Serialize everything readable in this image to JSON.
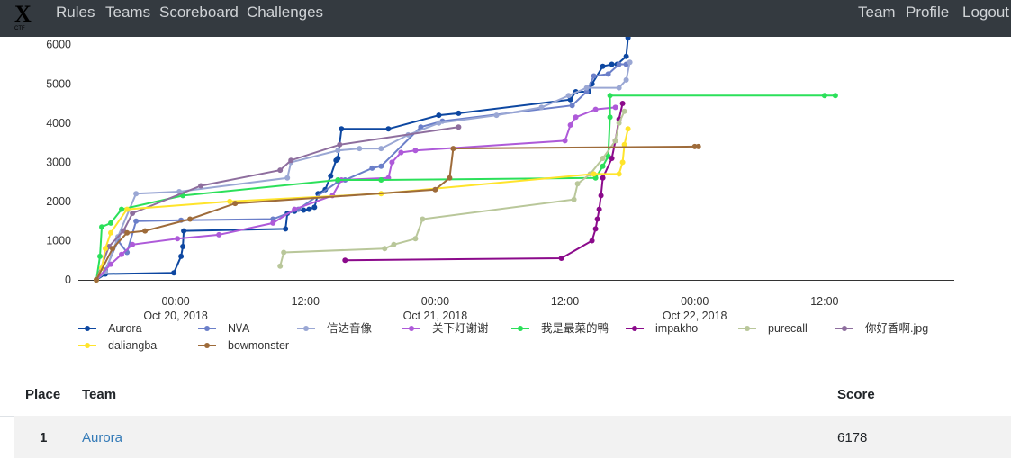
{
  "navbar": {
    "brand_icon": "x-logo-icon",
    "links_left": [
      "Rules",
      "Teams",
      "Scoreboard",
      "Challenges"
    ],
    "links_right": [
      "Team",
      "Profile",
      "Logout"
    ]
  },
  "chart_data": {
    "type": "line",
    "x_axis": {
      "ticks": [
        {
          "value": "2018-10-20 00:00",
          "label": [
            "00:00",
            "Oct 20, 2018"
          ]
        },
        {
          "value": "2018-10-20 12:00",
          "label": [
            "12:00",
            ""
          ]
        },
        {
          "value": "2018-10-21 00:00",
          "label": [
            "00:00",
            "Oct 21, 2018"
          ]
        },
        {
          "value": "2018-10-21 12:00",
          "label": [
            "12:00",
            ""
          ]
        },
        {
          "value": "2018-10-22 00:00",
          "label": [
            "00:00",
            "Oct 22, 2018"
          ]
        },
        {
          "value": "2018-10-22 12:00",
          "label": [
            "12:00",
            ""
          ]
        }
      ],
      "range": [
        "2018-10-19 15:00",
        "2018-10-23 00:00"
      ]
    },
    "y_axis": {
      "ticks": [
        0,
        1000,
        2000,
        3000,
        4000,
        5000,
        6000
      ],
      "range": [
        0,
        6200
      ]
    },
    "legend_position": "bottom",
    "series": [
      {
        "name": "Aurora",
        "color": "#0d47a1",
        "points": [
          [
            "2018-10-19 16:40",
            0
          ],
          [
            "2018-10-19 17:30",
            150
          ],
          [
            "2018-10-19 23:50",
            180
          ],
          [
            "2018-10-20 00:30",
            600
          ],
          [
            "2018-10-20 00:40",
            850
          ],
          [
            "2018-10-20 00:45",
            1250
          ],
          [
            "2018-10-20 10:10",
            1300
          ],
          [
            "2018-10-20 10:20",
            1700
          ],
          [
            "2018-10-20 11:00",
            1750
          ],
          [
            "2018-10-20 11:50",
            1780
          ],
          [
            "2018-10-20 12:20",
            1800
          ],
          [
            "2018-10-20 12:50",
            1850
          ],
          [
            "2018-10-20 13:10",
            2200
          ],
          [
            "2018-10-20 13:50",
            2300
          ],
          [
            "2018-10-20 14:20",
            2650
          ],
          [
            "2018-10-20 14:50",
            3050
          ],
          [
            "2018-10-20 15:00",
            3100
          ],
          [
            "2018-10-20 15:20",
            3850
          ],
          [
            "2018-10-20 19:40",
            3850
          ],
          [
            "2018-10-21 00:20",
            4200
          ],
          [
            "2018-10-21 02:10",
            4250
          ],
          [
            "2018-10-21 12:30",
            4600
          ],
          [
            "2018-10-21 13:00",
            4800
          ],
          [
            "2018-10-21 14:10",
            4800
          ],
          [
            "2018-10-21 14:30",
            5000
          ],
          [
            "2018-10-21 15:30",
            5450
          ],
          [
            "2018-10-21 16:20",
            5500
          ],
          [
            "2018-10-21 16:50",
            5500
          ],
          [
            "2018-10-21 17:40",
            5700
          ],
          [
            "2018-10-21 17:50",
            6178
          ]
        ]
      },
      {
        "name": "N\\/A",
        "color": "#6b7fc9",
        "points": [
          [
            "2018-10-19 16:40",
            0
          ],
          [
            "2018-10-19 17:30",
            250
          ],
          [
            "2018-10-19 18:40",
            1000
          ],
          [
            "2018-10-19 19:30",
            700
          ],
          [
            "2018-10-19 20:20",
            1500
          ],
          [
            "2018-10-20 00:30",
            1520
          ],
          [
            "2018-10-20 09:00",
            1550
          ],
          [
            "2018-10-20 11:20",
            1800
          ],
          [
            "2018-10-20 15:00",
            2500
          ],
          [
            "2018-10-20 15:40",
            2550
          ],
          [
            "2018-10-20 18:10",
            2850
          ],
          [
            "2018-10-20 19:00",
            2900
          ],
          [
            "2018-10-20 22:40",
            3900
          ],
          [
            "2018-10-21 00:40",
            4050
          ],
          [
            "2018-10-21 12:40",
            4450
          ],
          [
            "2018-10-21 14:00",
            4800
          ],
          [
            "2018-10-21 14:40",
            5200
          ],
          [
            "2018-10-21 16:00",
            5250
          ],
          [
            "2018-10-21 17:00",
            5500
          ],
          [
            "2018-10-21 17:40",
            5500
          ]
        ]
      },
      {
        "name": "信达音像",
        "color": "#9aa7d4",
        "points": [
          [
            "2018-10-19 16:40",
            0
          ],
          [
            "2018-10-19 17:30",
            200
          ],
          [
            "2018-10-19 18:40",
            1100
          ],
          [
            "2018-10-19 20:20",
            2200
          ],
          [
            "2018-10-20 00:20",
            2250
          ],
          [
            "2018-10-20 10:20",
            2600
          ],
          [
            "2018-10-20 10:40",
            3000
          ],
          [
            "2018-10-20 15:00",
            3300
          ],
          [
            "2018-10-20 17:00",
            3350
          ],
          [
            "2018-10-20 19:00",
            3350
          ],
          [
            "2018-10-20 21:30",
            3700
          ],
          [
            "2018-10-21 00:20",
            4000
          ],
          [
            "2018-10-21 05:40",
            4200
          ],
          [
            "2018-10-21 09:50",
            4400
          ],
          [
            "2018-10-21 12:20",
            4700
          ],
          [
            "2018-10-21 14:00",
            4900
          ],
          [
            "2018-10-21 17:00",
            4900
          ],
          [
            "2018-10-21 17:40",
            5100
          ],
          [
            "2018-10-21 18:00",
            5550
          ]
        ]
      },
      {
        "name": "关下灯谢谢",
        "color": "#ae5ad9",
        "points": [
          [
            "2018-10-19 16:40",
            0
          ],
          [
            "2018-10-19 18:00",
            400
          ],
          [
            "2018-10-19 19:00",
            650
          ],
          [
            "2018-10-19 20:00",
            900
          ],
          [
            "2018-10-20 00:10",
            1050
          ],
          [
            "2018-10-20 04:00",
            1150
          ],
          [
            "2018-10-20 09:00",
            1450
          ],
          [
            "2018-10-20 11:00",
            1800
          ],
          [
            "2018-10-20 14:30",
            2150
          ],
          [
            "2018-10-20 15:20",
            2550
          ],
          [
            "2018-10-20 19:40",
            2600
          ],
          [
            "2018-10-20 20:00",
            3000
          ],
          [
            "2018-10-20 20:50",
            3250
          ],
          [
            "2018-10-20 22:10",
            3300
          ],
          [
            "2018-10-21 12:00",
            3550
          ],
          [
            "2018-10-21 12:30",
            3950
          ],
          [
            "2018-10-21 13:00",
            4150
          ],
          [
            "2018-10-21 14:50",
            4350
          ],
          [
            "2018-10-21 16:40",
            4400
          ]
        ]
      },
      {
        "name": "我是最菜的鸭",
        "color": "#2be05a",
        "points": [
          [
            "2018-10-19 16:40",
            0
          ],
          [
            "2018-10-19 17:00",
            600
          ],
          [
            "2018-10-19 17:10",
            1350
          ],
          [
            "2018-10-19 18:00",
            1450
          ],
          [
            "2018-10-19 19:00",
            1800
          ],
          [
            "2018-10-20 00:40",
            2150
          ],
          [
            "2018-10-20 15:00",
            2550
          ],
          [
            "2018-10-20 19:00",
            2550
          ],
          [
            "2018-10-21 14:50",
            2600
          ],
          [
            "2018-10-21 15:30",
            2900
          ],
          [
            "2018-10-21 16:00",
            3150
          ],
          [
            "2018-10-21 16:10",
            4150
          ],
          [
            "2018-10-21 16:10",
            4700
          ],
          [
            "2018-10-22 12:00",
            4700
          ],
          [
            "2018-10-22 13:00",
            4700
          ]
        ]
      },
      {
        "name": "impakho",
        "color": "#8b0a8b",
        "points": [
          [
            "2018-10-20 15:40",
            500
          ],
          [
            "2018-10-21 11:40",
            550
          ],
          [
            "2018-10-21 14:30",
            1000
          ],
          [
            "2018-10-21 14:50",
            1300
          ],
          [
            "2018-10-21 15:00",
            1550
          ],
          [
            "2018-10-21 15:10",
            1800
          ],
          [
            "2018-10-21 15:20",
            2150
          ],
          [
            "2018-10-21 15:30",
            2600
          ],
          [
            "2018-10-21 16:20",
            3100
          ],
          [
            "2018-10-21 16:40",
            3550
          ],
          [
            "2018-10-21 17:00",
            4100
          ],
          [
            "2018-10-21 17:20",
            4500
          ]
        ]
      },
      {
        "name": "purecall",
        "color": "#b9c79a",
        "points": [
          [
            "2018-10-20 09:40",
            350
          ],
          [
            "2018-10-20 10:00",
            700
          ],
          [
            "2018-10-20 19:20",
            800
          ],
          [
            "2018-10-20 20:10",
            900
          ],
          [
            "2018-10-20 22:10",
            1050
          ],
          [
            "2018-10-20 22:50",
            1550
          ],
          [
            "2018-10-21 12:50",
            2050
          ],
          [
            "2018-10-21 13:10",
            2450
          ],
          [
            "2018-10-21 14:20",
            2700
          ],
          [
            "2018-10-21 15:30",
            3100
          ],
          [
            "2018-10-21 16:40",
            3550
          ],
          [
            "2018-10-21 17:00",
            4000
          ],
          [
            "2018-10-21 17:30",
            4300
          ]
        ]
      },
      {
        "name": "你好香啊.jpg",
        "color": "#8e6e9e",
        "points": [
          [
            "2018-10-19 16:40",
            0
          ],
          [
            "2018-10-19 17:50",
            850
          ],
          [
            "2018-10-19 19:10",
            1250
          ],
          [
            "2018-10-19 20:00",
            1700
          ],
          [
            "2018-10-20 02:20",
            2400
          ],
          [
            "2018-10-20 09:40",
            2800
          ],
          [
            "2018-10-20 10:40",
            3050
          ],
          [
            "2018-10-20 15:10",
            3450
          ],
          [
            "2018-10-21 02:10",
            3900
          ]
        ]
      },
      {
        "name": "daliangba",
        "color": "#ffe42b",
        "points": [
          [
            "2018-10-19 16:40",
            0
          ],
          [
            "2018-10-19 17:10",
            300
          ],
          [
            "2018-10-19 17:30",
            800
          ],
          [
            "2018-10-19 18:00",
            1200
          ],
          [
            "2018-10-19 19:30",
            1800
          ],
          [
            "2018-10-20 05:00",
            2000
          ],
          [
            "2018-10-20 19:00",
            2200
          ],
          [
            "2018-10-21 14:40",
            2700
          ],
          [
            "2018-10-21 17:00",
            2700
          ],
          [
            "2018-10-21 17:20",
            3000
          ],
          [
            "2018-10-21 17:30",
            3450
          ],
          [
            "2018-10-21 17:50",
            3850
          ]
        ]
      },
      {
        "name": "bowmonster",
        "color": "#9e6b3a",
        "points": [
          [
            "2018-10-19 16:40",
            0
          ],
          [
            "2018-10-19 18:10",
            800
          ],
          [
            "2018-10-19 19:30",
            1200
          ],
          [
            "2018-10-19 21:10",
            1250
          ],
          [
            "2018-10-20 01:20",
            1550
          ],
          [
            "2018-10-20 05:30",
            1950
          ],
          [
            "2018-10-21 00:00",
            2300
          ],
          [
            "2018-10-21 01:20",
            2600
          ],
          [
            "2018-10-21 01:40",
            3350
          ],
          [
            "2018-10-22 00:00",
            3400
          ],
          [
            "2018-10-22 00:20",
            3400
          ]
        ]
      }
    ]
  },
  "scoreboard": {
    "headers": {
      "place": "Place",
      "team": "Team",
      "score": "Score"
    },
    "rows": [
      {
        "place": "1",
        "team": "Aurora",
        "score": "6178"
      }
    ]
  }
}
